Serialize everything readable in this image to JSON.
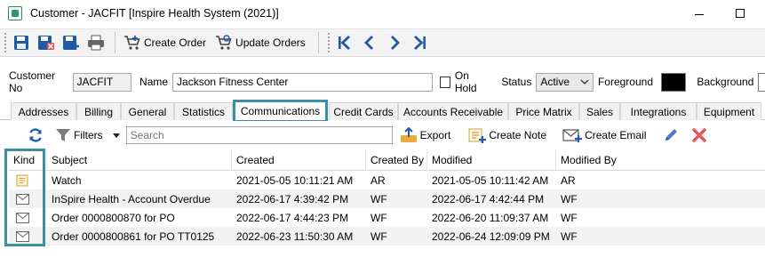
{
  "window": {
    "title": "Customer - JACFIT [Inspire Health System (2021)]",
    "app_icon": "customer-icon"
  },
  "toolbar": {
    "create_order_label": "Create Order",
    "update_orders_label": "Update Orders"
  },
  "fields": {
    "customer_no_label": "Customer No",
    "customer_no_value": "JACFIT",
    "name_label": "Name",
    "name_value": "Jackson Fitness Center",
    "on_hold_label": "On Hold",
    "status_label": "Status",
    "status_value": "Active",
    "foreground_label": "Foreground",
    "foreground_color": "#000000",
    "background_label": "Background"
  },
  "tabs": [
    {
      "label": "Addresses"
    },
    {
      "label": "Billing"
    },
    {
      "label": "General"
    },
    {
      "label": "Statistics"
    },
    {
      "label": "Communications",
      "active": true
    },
    {
      "label": "Credit Cards"
    },
    {
      "label": "Accounts Receivable"
    },
    {
      "label": "Price Matrix"
    },
    {
      "label": "Sales"
    },
    {
      "label": "Integrations"
    },
    {
      "label": "Equipment"
    }
  ],
  "comm_toolbar": {
    "filters_label": "Filters",
    "search_placeholder": "Search",
    "export_label": "Export",
    "create_note_label": "Create Note",
    "create_email_label": "Create Email"
  },
  "grid": {
    "columns": [
      "Kind",
      "Subject",
      "Created",
      "Created By",
      "Modified",
      "Modified By"
    ],
    "rows": [
      {
        "kind": "note-icon",
        "subject": "Watch",
        "created": "2021-05-05 10:11:21 AM",
        "created_by": "AR",
        "modified": "2021-05-05 10:11:42 AM",
        "modified_by": "AR"
      },
      {
        "kind": "email-icon",
        "subject": "InSpire Health - Account Overdue",
        "created": "2022-06-17 4:39:42 PM",
        "created_by": "WF",
        "modified": "2022-06-17 4:42:44 PM",
        "modified_by": "WF"
      },
      {
        "kind": "email-icon",
        "subject": "Order 0000800870 for PO",
        "created": "2022-06-17 4:44:23 PM",
        "created_by": "WF",
        "modified": "2022-06-20 11:09:37 AM",
        "modified_by": "WF"
      },
      {
        "kind": "email-icon",
        "subject": "Order 0000800861 for PO TT0125",
        "created": "2022-06-23 11:50:30 AM",
        "created_by": "WF",
        "modified": "2022-06-24 12:09:09 PM",
        "modified_by": "WF"
      }
    ]
  },
  "colors": {
    "highlight": "#3a8fa3",
    "toolbar_blue": "#1e5aa8",
    "delete_red": "#d9534f"
  }
}
